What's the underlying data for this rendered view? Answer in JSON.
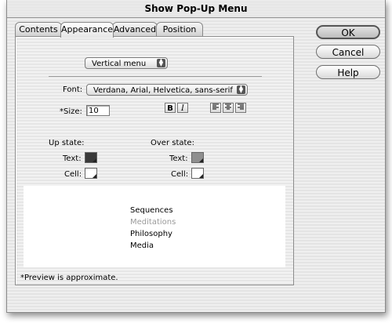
{
  "window": {
    "title": "Show Pop-Up Menu"
  },
  "tabs": [
    "Contents",
    "Appearance",
    "Advanced",
    "Position"
  ],
  "active_tab": "Appearance",
  "orientation": {
    "value": "Vertical menu"
  },
  "font": {
    "label": "Font:",
    "value": "Verdana, Arial, Helvetica, sans-serif"
  },
  "size": {
    "label": "*Size:",
    "value": "10"
  },
  "format": {
    "bold": "B",
    "italic": "I"
  },
  "up_state": {
    "heading": "Up state:",
    "text_label": "Text:",
    "cell_label": "Cell:",
    "text_color": "#3a3a3a",
    "cell_color": "#ffffff"
  },
  "over_state": {
    "heading": "Over state:",
    "text_label": "Text:",
    "cell_label": "Cell:",
    "text_color": "#8f8f8f",
    "cell_color": "#ffffff"
  },
  "preview": {
    "items": [
      "Sequences",
      "Meditations",
      "Philosophy",
      "Media"
    ],
    "highlighted_index": 1,
    "note": "*Preview is approximate."
  },
  "buttons": {
    "ok": "OK",
    "cancel": "Cancel",
    "help": "Help"
  }
}
